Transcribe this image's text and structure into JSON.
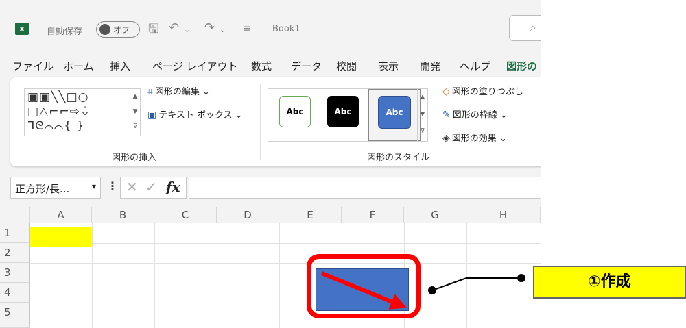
{
  "title_bar": {
    "app_icon": "excel-icon",
    "autosave_label": "自動保存",
    "autosave_state": "オフ",
    "book_name": "Book1"
  },
  "menu": [
    "ファイル",
    "ホーム",
    "挿入",
    "ページ レイアウト",
    "数式",
    "データ",
    "校閲",
    "表示",
    "開発",
    "ヘルプ",
    "図形の"
  ],
  "ribbon": {
    "insert_group": {
      "edit_shape": "図形の編集",
      "text_box": "テキスト ボックス",
      "label": "図形の挿入"
    },
    "style_group": {
      "swatches": [
        "Abc",
        "Abc",
        "Abc"
      ],
      "fill": "図形の塗りつぶし",
      "outline": "図形の枠線",
      "effects": "図形の効果",
      "label": "図形のスタイル"
    }
  },
  "formula_bar": {
    "name_box": "正方形/長...",
    "fx": "fx"
  },
  "sheet": {
    "columns": [
      "A",
      "B",
      "C",
      "D",
      "E",
      "F",
      "G",
      "H"
    ],
    "rows": [
      "1",
      "2",
      "3",
      "4",
      "5"
    ]
  },
  "annotation": {
    "label": "①作成",
    "colors": {
      "highlight": "#ff0000",
      "callout": "#ffff00",
      "shape_fill": "#4472c4"
    }
  }
}
